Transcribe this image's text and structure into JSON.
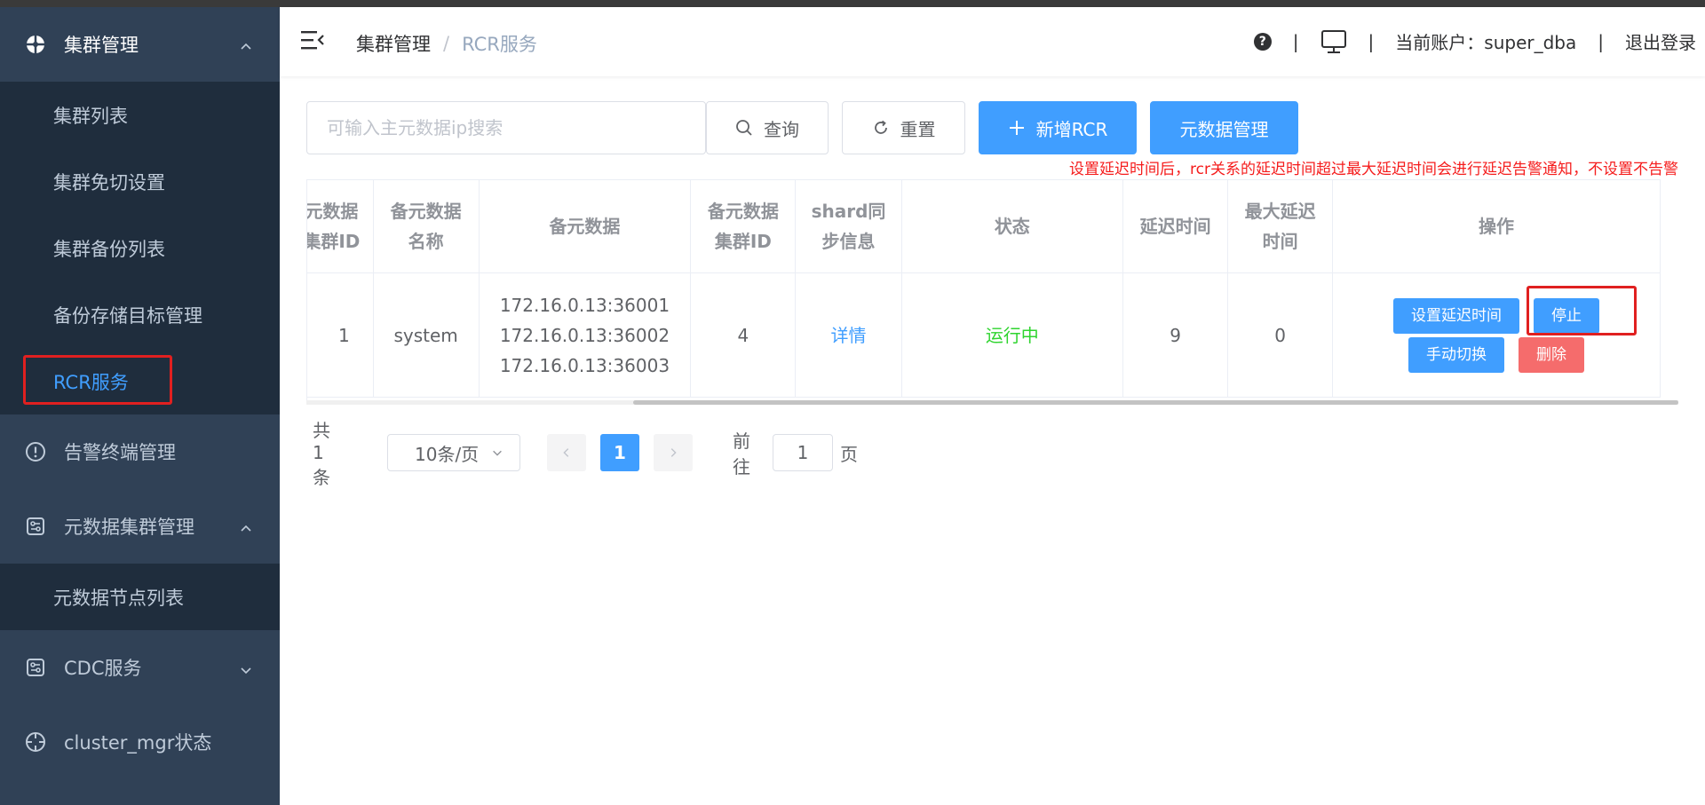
{
  "sidebar": {
    "groups": [
      {
        "label": "集群管理",
        "icon": "aperture-icon",
        "expanded": true,
        "items": [
          "集群列表",
          "集群免切设置",
          "集群备份列表",
          "备份存储目标管理",
          "RCR服务"
        ],
        "active_item": "RCR服务"
      },
      {
        "label": "告警终端管理",
        "icon": "alert-circle-icon"
      },
      {
        "label": "元数据集群管理",
        "icon": "sliders-icon",
        "expanded": true,
        "items": [
          "元数据节点列表"
        ]
      },
      {
        "label": "CDC服务",
        "icon": "sliders-icon",
        "expanded": false
      },
      {
        "label": "cluster_mgr状态",
        "icon": "crosshair-icon"
      }
    ]
  },
  "header": {
    "breadcrumb": [
      "集群管理",
      "RCR服务"
    ],
    "breadcrumb_sep": "/",
    "pipe": "|",
    "account_label": "当前账户：super_dba",
    "logout": "退出登录"
  },
  "toolbar": {
    "search_placeholder": "可输入主元数据ip搜索",
    "query_label": "查询",
    "reset_label": "重置",
    "add_label": "新增RCR",
    "meta_label": "元数据管理",
    "notice": "设置延迟时间后，rcr关系的延迟时间超过最大延迟时间会进行延迟告警通知，不设置不告警"
  },
  "table": {
    "headers": [
      "元数据集群ID",
      "备元数据名称",
      "备元数据",
      "备元数据集群ID",
      "shard同步信息",
      "状态",
      "延迟时间",
      "最大延迟时间",
      "操作"
    ],
    "rows": [
      {
        "master_cluster_id": "1",
        "name": "system",
        "nodes": [
          "172.16.0.13:36001",
          "172.16.0.13:36002",
          "172.16.0.13:36003"
        ],
        "cluster_id": "4",
        "shard_sync": "详情",
        "status": "运行中",
        "delay": "9",
        "max_delay": "0",
        "actions": {
          "set_delay": "设置延迟时间",
          "stop": "停止",
          "switch": "手动切换",
          "delete": "删除"
        }
      }
    ]
  },
  "pagination": {
    "total": "共 1 条",
    "page_size": "10条/页",
    "current": "1",
    "goto_prefix": "前往",
    "goto_value": "1",
    "goto_suffix": "页"
  },
  "colors": {
    "sidebar_bg": "#304156",
    "submenu_bg": "#1f2d3d",
    "primary": "#409eff",
    "danger": "#f56c6c",
    "success": "#2ed42e",
    "notice": "#f51c1c"
  }
}
